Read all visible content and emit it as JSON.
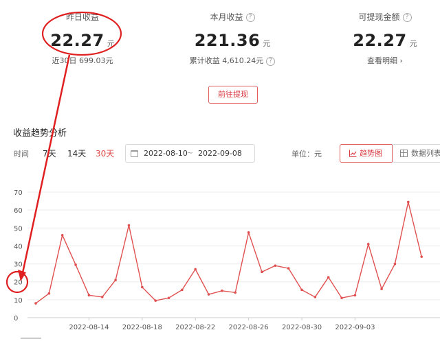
{
  "stats": [
    {
      "label": "昨日收益",
      "value": "22.27",
      "unit": "元",
      "sub": "近30日 699.03元",
      "help": false
    },
    {
      "label": "本月收益",
      "value": "221.36",
      "unit": "元",
      "sub": "累计收益 4,610.24元",
      "help": true
    },
    {
      "label": "可提现金额",
      "value": "22.27",
      "unit": "元",
      "sub": "查看明细 ›",
      "help": true
    }
  ],
  "withdraw_label": "前往提现",
  "section_title": "收益趋势分析",
  "toolbar": {
    "time_label": "时间",
    "ranges": [
      "7天",
      "14天",
      "30天"
    ],
    "active_range": "30天",
    "date_start": "2022-08-10",
    "date_sep": "~",
    "date_end": "2022-09-08",
    "unit_label": "单位：元",
    "view_trend": "趋势图",
    "view_table": "数据列表"
  },
  "annotation_color": "#e02020",
  "chart_data": {
    "type": "line",
    "ylim": [
      0,
      70
    ],
    "yticks": [
      0,
      10,
      20,
      30,
      40,
      50,
      60,
      70
    ],
    "x": [
      "2022-08-10",
      "2022-08-11",
      "2022-08-12",
      "2022-08-13",
      "2022-08-14",
      "2022-08-15",
      "2022-08-16",
      "2022-08-17",
      "2022-08-18",
      "2022-08-19",
      "2022-08-20",
      "2022-08-21",
      "2022-08-22",
      "2022-08-23",
      "2022-08-24",
      "2022-08-25",
      "2022-08-26",
      "2022-08-27",
      "2022-08-28",
      "2022-08-29",
      "2022-08-30",
      "2022-08-31",
      "2022-09-01",
      "2022-09-02",
      "2022-09-03",
      "2022-09-04",
      "2022-09-05",
      "2022-09-06",
      "2022-09-07",
      "2022-09-08"
    ],
    "xticks": [
      "2022-08-14",
      "2022-08-18",
      "2022-08-22",
      "2022-08-26",
      "2022-08-30",
      "2022-09-03"
    ],
    "series": [
      {
        "color": "#e05050",
        "values": [
          8,
          13.5,
          46,
          29.5,
          12.5,
          11.5,
          21,
          51.5,
          17,
          9.5,
          11,
          15.5,
          27,
          13,
          15,
          14,
          47.5,
          25.5,
          29,
          27.5,
          15.5,
          11.5,
          22.5,
          11,
          12.5,
          41,
          16,
          30,
          64.5,
          34
        ]
      }
    ],
    "grid": true
  }
}
